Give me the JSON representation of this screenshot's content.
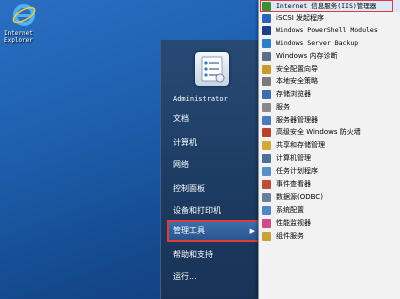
{
  "desktop": {
    "ie_icon": {
      "icon": "internet-explorer-icon",
      "label": "Internet\nExplorer"
    }
  },
  "start_menu": {
    "user_picture_icon": "checklist-icon",
    "items": [
      {
        "label": "Administrator",
        "mono": true
      },
      {
        "label": "文档"
      },
      {
        "label": "计算机"
      },
      {
        "label": "网络"
      },
      {
        "label": "控制面板"
      },
      {
        "label": "设备和打印机"
      },
      {
        "label": "管理工具",
        "selected": true,
        "arrow": "▶"
      },
      {
        "label": "帮助和支持"
      },
      {
        "label": "运行..."
      }
    ]
  },
  "admin_tools": {
    "items": [
      {
        "label": "Internet 信息服务(IIS)管理器",
        "icon": "iis-manager-icon",
        "color": "#3a8f3a",
        "selected": true
      },
      {
        "label": "iSCSI 发起程序",
        "icon": "iscsi-icon",
        "color": "#2a66b8"
      },
      {
        "label": "Windows PowerShell Modules",
        "icon": "powershell-icon",
        "color": "#1d3f8a"
      },
      {
        "label": "Windows Server Backup",
        "icon": "backup-icon",
        "color": "#2f7fc4"
      },
      {
        "label": "Windows 内存诊断",
        "icon": "memory-diagnostic-icon",
        "color": "#5a6f8a"
      },
      {
        "label": "安全配置向导",
        "icon": "security-wizard-icon",
        "color": "#c99a2e"
      },
      {
        "label": "本地安全策略",
        "icon": "local-security-policy-icon",
        "color": "#7a7a7a"
      },
      {
        "label": "存储浏览器",
        "icon": "storage-explorer-icon",
        "color": "#3b6fb0"
      },
      {
        "label": "服务",
        "icon": "services-icon",
        "color": "#8a8a8a"
      },
      {
        "label": "服务器管理器",
        "icon": "server-manager-icon",
        "color": "#4a7bbf"
      },
      {
        "label": "高级安全 Windows 防火墙",
        "icon": "firewall-icon",
        "color": "#b8412e"
      },
      {
        "label": "共享和存储管理",
        "icon": "share-storage-icon",
        "color": "#d1a83a"
      },
      {
        "label": "计算机管理",
        "icon": "computer-management-icon",
        "color": "#4d6f95"
      },
      {
        "label": "任务计划程序",
        "icon": "task-scheduler-icon",
        "color": "#5b8fc9"
      },
      {
        "label": "事件查看器",
        "icon": "event-viewer-icon",
        "color": "#c24a3a"
      },
      {
        "label": "数据源(ODBC)",
        "icon": "odbc-icon",
        "color": "#6a7f9a"
      },
      {
        "label": "系统配置",
        "icon": "system-config-icon",
        "color": "#4f86c6"
      },
      {
        "label": "性能监视器",
        "icon": "performance-monitor-icon",
        "color": "#d14a8a"
      },
      {
        "label": "组件服务",
        "icon": "component-services-icon",
        "color": "#c9a13a"
      }
    ]
  }
}
